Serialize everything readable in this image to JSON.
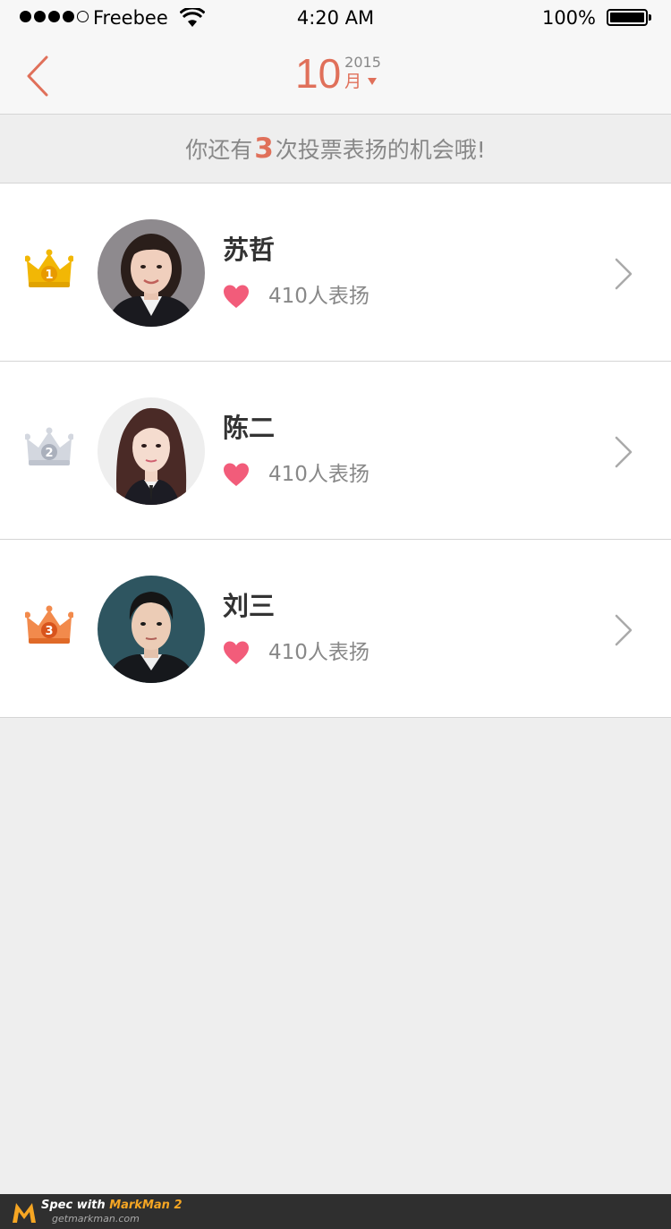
{
  "status_bar": {
    "carrier": "Freebee",
    "time": "4:20 AM",
    "battery": "100%"
  },
  "nav": {
    "month_number": "10",
    "year": "2015",
    "month_label": "月"
  },
  "banner": {
    "prefix": "你还有",
    "count": "3",
    "suffix": "次投票表扬的机会哦!"
  },
  "rows": [
    {
      "rank": "1",
      "name": "苏哲",
      "praise": "410人表扬",
      "crown_color": "#f2b705"
    },
    {
      "rank": "2",
      "name": "陈二",
      "praise": "410人表扬",
      "crown_color": "#c9ced8"
    },
    {
      "rank": "3",
      "name": "刘三",
      "praise": "410人表扬",
      "crown_color": "#f07a3c"
    }
  ],
  "colors": {
    "accent": "#e0705a",
    "heart": "#f25c7a",
    "divider": "#d5d5d5",
    "row_bg": "#ffffff",
    "page_bg": "#eeeeee"
  },
  "footer": {
    "tagline_prefix": "Spec with ",
    "tagline_brand": "MarkMan 2",
    "site": "getmarkman.com"
  }
}
